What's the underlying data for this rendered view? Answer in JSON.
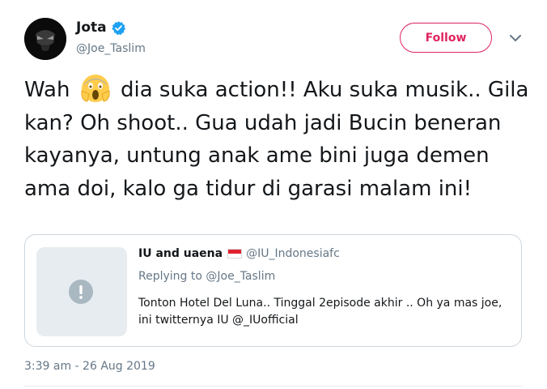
{
  "author": {
    "name": "Jota",
    "handle": "@Joe_Taslim",
    "avatar_icon": "masked-face-avatar",
    "verified_icon": "verified-badge-icon"
  },
  "follow_button": {
    "label": "Follow",
    "color": "#e0245e"
  },
  "caret_icon": "chevron-down-icon",
  "tweet": {
    "text_before_emoji": "Wah",
    "emoji": "face-screaming-in-fear-emoji",
    "text_after_emoji": "dia suka action!! Aku suka musik.. Gila kan? Oh shoot.. Gua udah jadi Bucin beneran kayanya, untung anak ame bini juga demen ama doi, kalo ga tidur di garasi malam ini!"
  },
  "quoted_tweet": {
    "name": "IU and uaena",
    "flag": "indonesia-flag",
    "handle": "@IU_Indonesiafc",
    "replying_prefix": "Replying to ",
    "replying_to": "@Joe_Taslim",
    "text": "Tonton Hotel Del Luna.. Tinggal 2episode akhir .. Oh ya mas joe, ini twitternya IU @_IUofficial",
    "media_icon": "media-unavailable-alert-icon"
  },
  "timestamp": "3:39 am - 26 Aug 2019",
  "colors": {
    "text": "#14171a",
    "secondary": "#657786",
    "verified": "#1da1f2",
    "border": "#ccd6dd"
  }
}
